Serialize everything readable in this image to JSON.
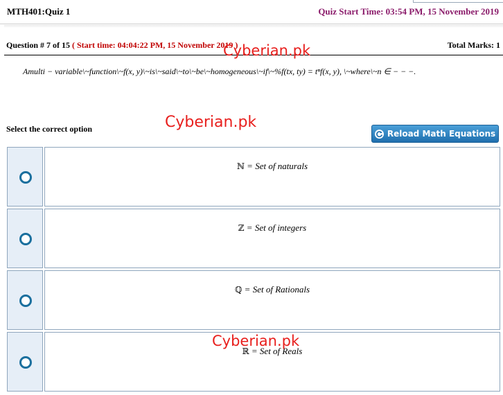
{
  "header": {
    "course_title": "MTH401:Quiz 1",
    "quiz_start": "Quiz Start Time: 03:54 PM, 15 November 2019"
  },
  "question_bar": {
    "number": "Question # 7 of 15",
    "start_time": "( Start time: 04:04:22 PM, 15 November 2019 )",
    "total_marks": "Total Marks: 1"
  },
  "question": {
    "text": "Amulti − variable\\~function\\~f(x, y)\\~is\\~said\\~to\\~be\\~homogeneous\\~if\\~%f(tx, ty) = tⁿf(x, y), \\~where\\~n ∈ − − −."
  },
  "watermarks": [
    "Cyberian.pk",
    "Cyberian.pk",
    "Cyberian.pk"
  ],
  "select_label": "Select the correct option",
  "reload_button": {
    "label": "Reload Math Equations",
    "icon": "reload-icon"
  },
  "options": [
    {
      "symbol": "ℕ",
      "text": " = Set of naturals"
    },
    {
      "symbol": "ℤ",
      "text": " = Set of integers"
    },
    {
      "symbol": "ℚ",
      "text": " = Set of Rationals"
    },
    {
      "symbol": "ℝ",
      "text": " = Set of Reals"
    }
  ],
  "colors": {
    "quiz_start": "#8b1c6b",
    "start_time": "#c00000",
    "watermark": "#e8201e",
    "radio": "#1a6f9e",
    "button": "#1f6fae"
  }
}
